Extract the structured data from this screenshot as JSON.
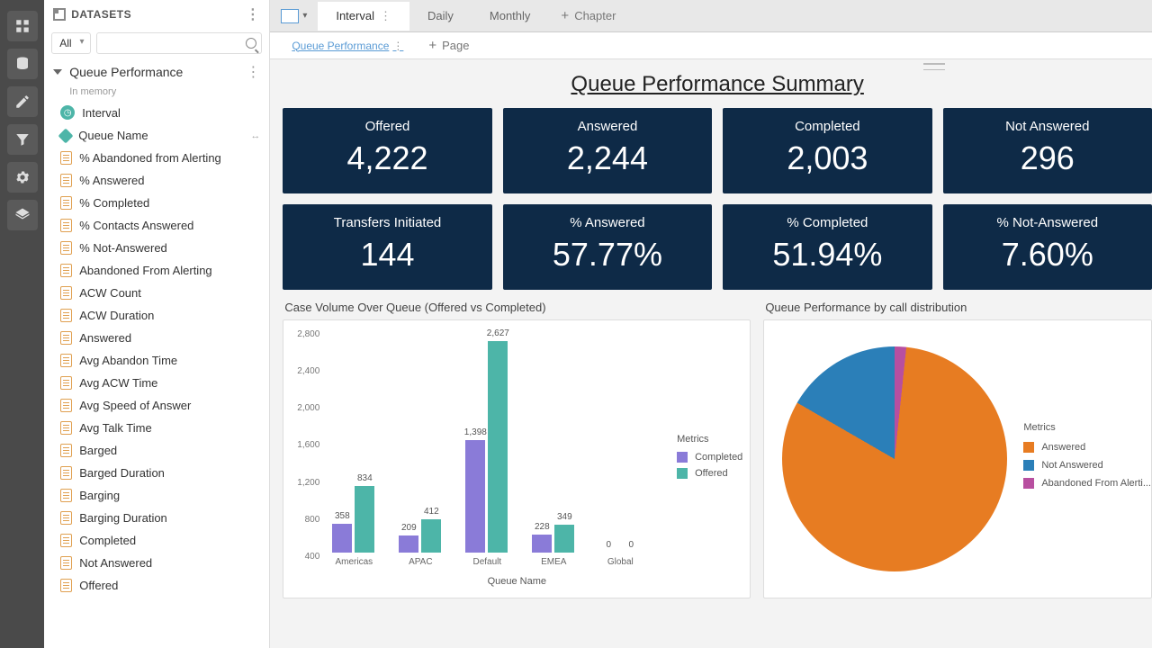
{
  "rail": {
    "items": [
      "grid-icon",
      "database-icon",
      "pencil-icon",
      "funnel-icon",
      "gear-icon",
      "layers-icon"
    ]
  },
  "sidebar": {
    "title": "DATASETS",
    "filter": "All",
    "search_placeholder": "",
    "dataset": {
      "name": "Queue Performance",
      "sub": "In memory"
    },
    "fields": [
      {
        "kind": "time",
        "label": "Interval"
      },
      {
        "kind": "dim",
        "label": "Queue Name"
      },
      {
        "kind": "meas",
        "label": "% Abandoned from Alerting"
      },
      {
        "kind": "meas",
        "label": "% Answered"
      },
      {
        "kind": "meas",
        "label": "% Completed"
      },
      {
        "kind": "meas",
        "label": "% Contacts Answered"
      },
      {
        "kind": "meas",
        "label": "% Not-Answered"
      },
      {
        "kind": "meas",
        "label": "Abandoned From Alerting"
      },
      {
        "kind": "meas",
        "label": "ACW Count"
      },
      {
        "kind": "meas",
        "label": "ACW Duration"
      },
      {
        "kind": "meas",
        "label": "Answered"
      },
      {
        "kind": "meas",
        "label": "Avg Abandon Time"
      },
      {
        "kind": "meas",
        "label": "Avg ACW Time"
      },
      {
        "kind": "meas",
        "label": "Avg Speed of Answer"
      },
      {
        "kind": "meas",
        "label": "Avg Talk Time"
      },
      {
        "kind": "meas",
        "label": "Barged"
      },
      {
        "kind": "meas",
        "label": "Barged Duration"
      },
      {
        "kind": "meas",
        "label": "Barging"
      },
      {
        "kind": "meas",
        "label": "Barging Duration"
      },
      {
        "kind": "meas",
        "label": "Completed"
      },
      {
        "kind": "meas",
        "label": "Not Answered"
      },
      {
        "kind": "meas",
        "label": "Offered"
      }
    ]
  },
  "tabs": {
    "items": [
      "Interval",
      "Daily",
      "Monthly"
    ],
    "add": "Chapter"
  },
  "sub_tabs": {
    "items": [
      "Queue Performance"
    ],
    "add": "Page"
  },
  "title": "Queue Performance Summary",
  "cards": [
    {
      "label": "Offered",
      "value": "4,222"
    },
    {
      "label": "Answered",
      "value": "2,244"
    },
    {
      "label": "Completed",
      "value": "2,003"
    },
    {
      "label": "Not Answered",
      "value": "296"
    },
    {
      "label": "Transfers Initiated",
      "value": "144"
    },
    {
      "label": "% Answered",
      "value": "57.77%"
    },
    {
      "label": "% Completed",
      "value": "51.94%"
    },
    {
      "label": "% Not-Answered",
      "value": "7.60%"
    }
  ],
  "bar": {
    "title": "Case Volume Over Queue (Offered vs Completed)",
    "legend_title": "Metrics",
    "legend": [
      "Completed",
      "Offered"
    ],
    "xlabel": "Queue Name"
  },
  "pie": {
    "title": "Queue Performance by call distribution",
    "legend_title": "Metrics",
    "legend": [
      "Answered",
      "Not Answered",
      "Abandoned From Alerti..."
    ]
  },
  "chart_data": [
    {
      "type": "bar",
      "title": "Case Volume Over Queue (Offered vs Completed)",
      "categories": [
        "Americas",
        "APAC",
        "Default",
        "EMEA",
        "Global"
      ],
      "series": [
        {
          "name": "Completed",
          "values": [
            358,
            209,
            1398,
            228,
            0
          ]
        },
        {
          "name": "Offered",
          "values": [
            834,
            412,
            2627,
            349,
            0
          ]
        }
      ],
      "xlabel": "Queue Name",
      "ylabel": "",
      "ylim": [
        0,
        2800
      ],
      "yticks": [
        400,
        800,
        1200,
        1600,
        2000,
        2400,
        2800
      ]
    },
    {
      "type": "pie",
      "title": "Queue Performance by call distribution",
      "series": [
        {
          "name": "Answered",
          "value": 2244,
          "color": "#e77c22"
        },
        {
          "name": "Not Answered",
          "value": 296,
          "color": "#2b7fb8"
        },
        {
          "name": "Abandoned From Alerting",
          "value": 40,
          "color": "#b84fa0"
        }
      ]
    }
  ]
}
